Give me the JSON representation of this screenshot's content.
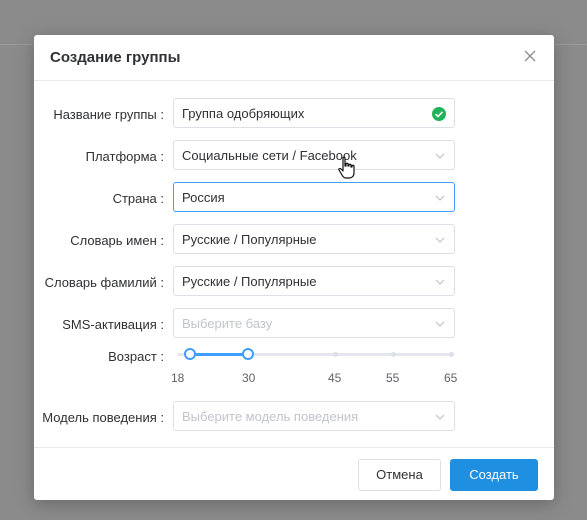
{
  "dialog": {
    "title": "Создание группы",
    "fields": {
      "group_name": {
        "label": "Название группы :",
        "value": "Группа одобряющих"
      },
      "platform": {
        "label": "Платформа :",
        "value": "Социальные сети / Facebook"
      },
      "country": {
        "label": "Страна :",
        "value": "Россия"
      },
      "names_dict": {
        "label": "Словарь имен :",
        "value": "Русские / Популярные"
      },
      "surnames_dict": {
        "label": "Словарь фамилий :",
        "value": "Русские / Популярные"
      },
      "sms": {
        "label": "SMS-активация :",
        "placeholder": "Выберите базу"
      },
      "age": {
        "label": "Возраст :",
        "min": 18,
        "max": 30,
        "ticks": [
          "18",
          "30",
          "45",
          "55",
          "65"
        ]
      },
      "behavior": {
        "label": "Модель поведения :",
        "placeholder": "Выберите модель поведения"
      }
    },
    "buttons": {
      "cancel": "Отмена",
      "create": "Создать"
    }
  },
  "colors": {
    "accent": "#409eff",
    "primary_button": "#1e8fe1",
    "valid": "#21b35a"
  },
  "icons": [
    "close-icon",
    "check-circle-icon",
    "chevron-down-icon",
    "hand-cursor-icon"
  ]
}
